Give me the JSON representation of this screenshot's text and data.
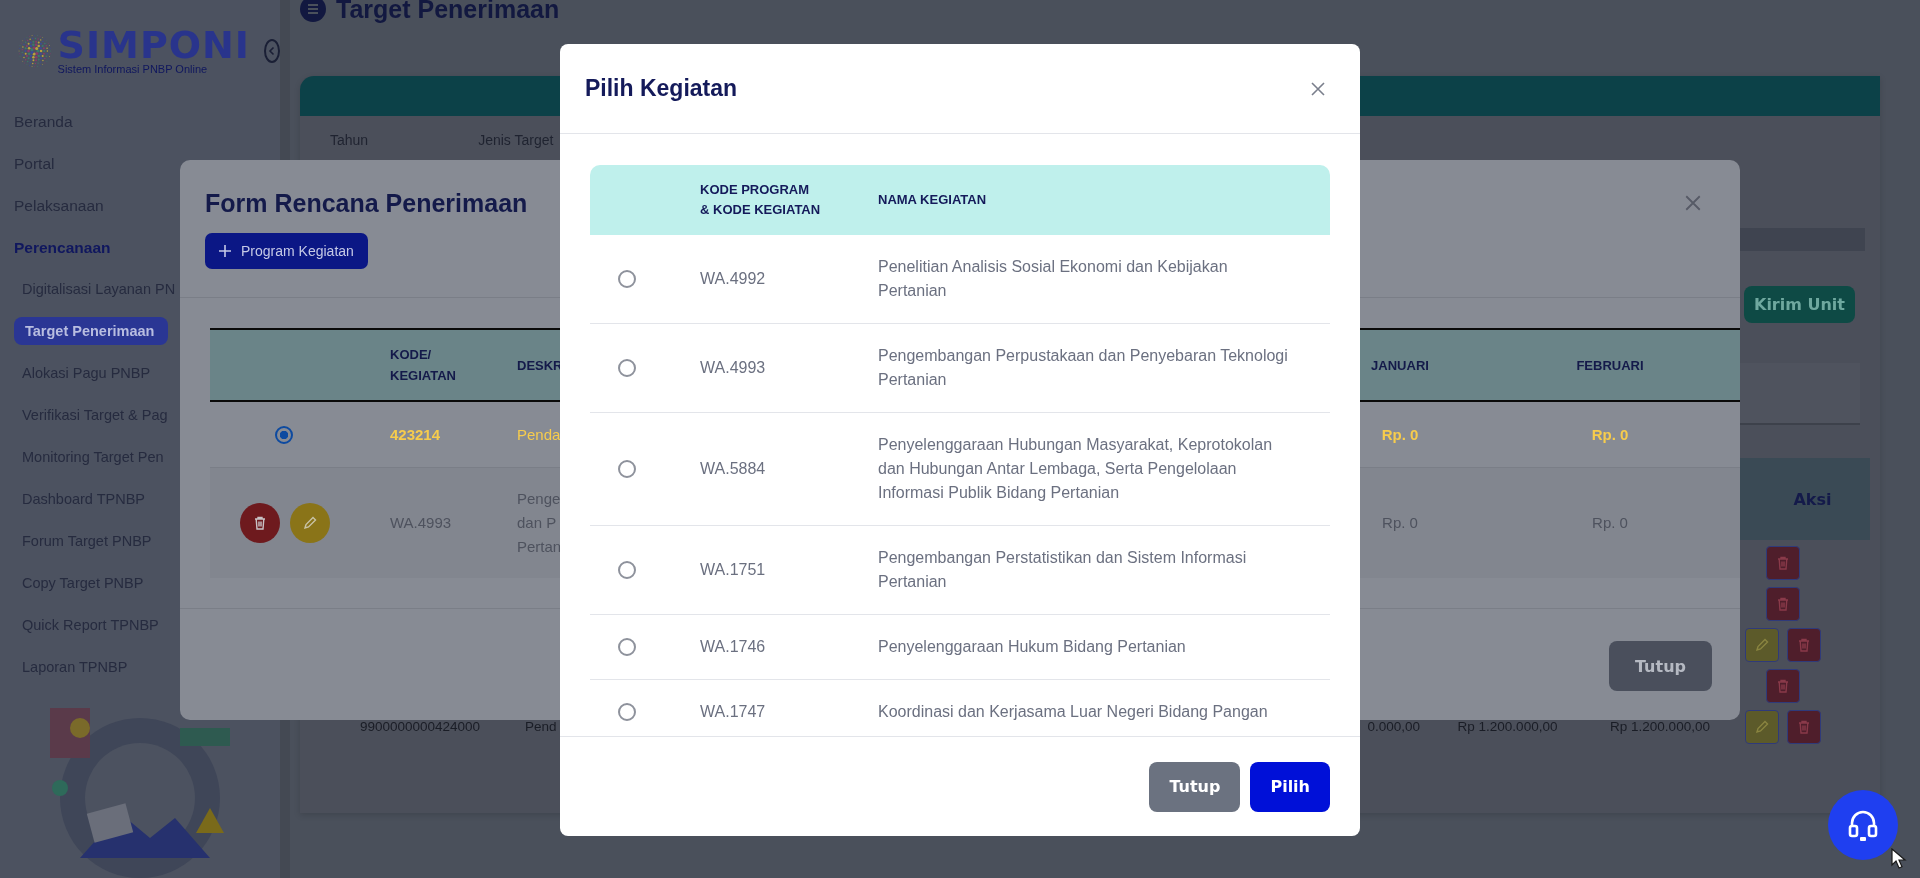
{
  "sidebar": {
    "logo": {
      "title": "SIMPONI",
      "subtitle": "Sistem Informasi PNBP Online"
    },
    "items": [
      {
        "label": "Beranda",
        "selected": false
      },
      {
        "label": "Portal",
        "selected": false
      },
      {
        "label": "Pelaksanaan",
        "selected": false
      },
      {
        "label": "Perencanaan",
        "selected": true,
        "children": [
          {
            "label": "Digitalisasi Layanan PN",
            "selected": false
          },
          {
            "label": "Target Penerimaan",
            "selected": true
          },
          {
            "label": "Alokasi Pagu PNBP",
            "selected": false
          },
          {
            "label": "Verifikasi Target & Pag",
            "selected": false
          },
          {
            "label": "Monitoring Target Pen",
            "selected": false
          },
          {
            "label": "Dashboard TPNBP",
            "selected": false
          },
          {
            "label": "Forum Target PNBP",
            "selected": false
          },
          {
            "label": "Copy Target PNBP",
            "selected": false
          },
          {
            "label": "Quick Report TPNBP",
            "selected": false
          },
          {
            "label": "Laporan TPNBP",
            "selected": false
          }
        ]
      }
    ]
  },
  "page": {
    "title": "Target Penerimaan",
    "filter_labels": [
      "Tahun",
      "Jenis Target"
    ],
    "send_button": "Kirim Unit",
    "table": {
      "columns": [
        "Aksi"
      ],
      "rows": [
        {
          "editable": false
        },
        {
          "editable": false
        },
        {
          "editable": true
        },
        {
          "editable": false
        },
        {
          "editable": true,
          "cells": [
            "9900000000424000",
            "Pend",
            "0.000,00",
            "Rp 1.200.000,00",
            "Rp 1.200.000,00"
          ]
        }
      ]
    }
  },
  "form_modal": {
    "title": "Form Rencana Penerimaan",
    "add_button": "Program Kegiatan",
    "table": {
      "columns": [
        "KODE/\nKEGIATAN",
        "DESKR",
        "JANUARI",
        "FEBRUARI"
      ],
      "rows": [
        {
          "kind": "program",
          "selected": true,
          "code": "423214",
          "description": "Penda",
          "januari": "Rp. 0",
          "februari": "Rp. 0"
        },
        {
          "kind": "activity",
          "code": "WA.4993",
          "description": "Penge\ndan P\nPertan",
          "januari": "Rp. 0",
          "februari": "Rp. 0"
        }
      ]
    },
    "close_button": "Tutup"
  },
  "pick_modal": {
    "title": "Pilih Kegiatan",
    "table": {
      "columns": [
        "KODE PROGRAM\n& KODE KEGIATAN",
        "NAMA KEGIATAN"
      ],
      "rows": [
        {
          "selected": false,
          "code": "WA.4992",
          "name": "Penelitian Analisis Sosial Ekonomi dan Kebijakan Pertanian"
        },
        {
          "selected": false,
          "code": "WA.4993",
          "name": "Pengembangan Perpustakaan dan Penyebaran Teknologi Pertanian"
        },
        {
          "selected": false,
          "code": "WA.5884",
          "name": "Penyelenggaraan Hubungan Masyarakat, Keprotokolan dan Hubungan Antar Lembaga, Serta Pengelolaan Informasi Publik Bidang Pertanian"
        },
        {
          "selected": false,
          "code": "WA.1751",
          "name": "Pengembangan Perstatistikan dan Sistem Informasi Pertanian"
        },
        {
          "selected": false,
          "code": "WA.1746",
          "name": "Penyelenggaraan Hukum Bidang Pertanian"
        },
        {
          "selected": false,
          "code": "WA.1747",
          "name": "Koordinasi dan Kerjasama Luar Negeri Bidang Pangan"
        }
      ]
    },
    "buttons": [
      {
        "label": "Tutup",
        "kind": "secondary"
      },
      {
        "label": "Pilih",
        "kind": "primary"
      }
    ]
  }
}
